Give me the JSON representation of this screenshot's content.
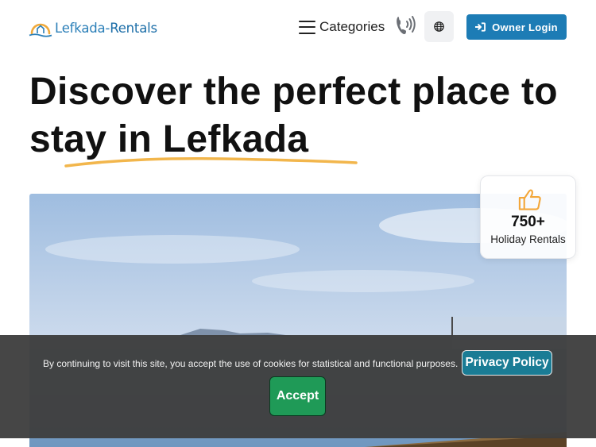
{
  "brand": {
    "name_part1": "Lefkada-",
    "name_part2": "Rentals"
  },
  "nav": {
    "categories_label": "Categories",
    "owner_login_label": "Owner Login"
  },
  "hero": {
    "title": "Discover the perfect place to stay in Lefkada"
  },
  "stats": {
    "value": "750+",
    "label": "Holiday Rentals"
  },
  "cookie_banner": {
    "text": "By continuing to visit this site, you accept the use of cookies for statistical and functional purposes.",
    "privacy_label": "Privacy Policy",
    "accept_label": "Accept"
  },
  "colors": {
    "brand_blue": "#1d7cb5",
    "underline_orange": "#f2b64c",
    "privacy_teal": "#1a7c95",
    "accept_green": "#1f9a57",
    "thumb_orange": "#f3a73a"
  },
  "icons": {
    "menu": "hamburger-icon",
    "phone": "phone-ringing-icon",
    "language": "globe-icon",
    "login": "sign-in-icon",
    "stat": "thumbs-up-icon"
  }
}
